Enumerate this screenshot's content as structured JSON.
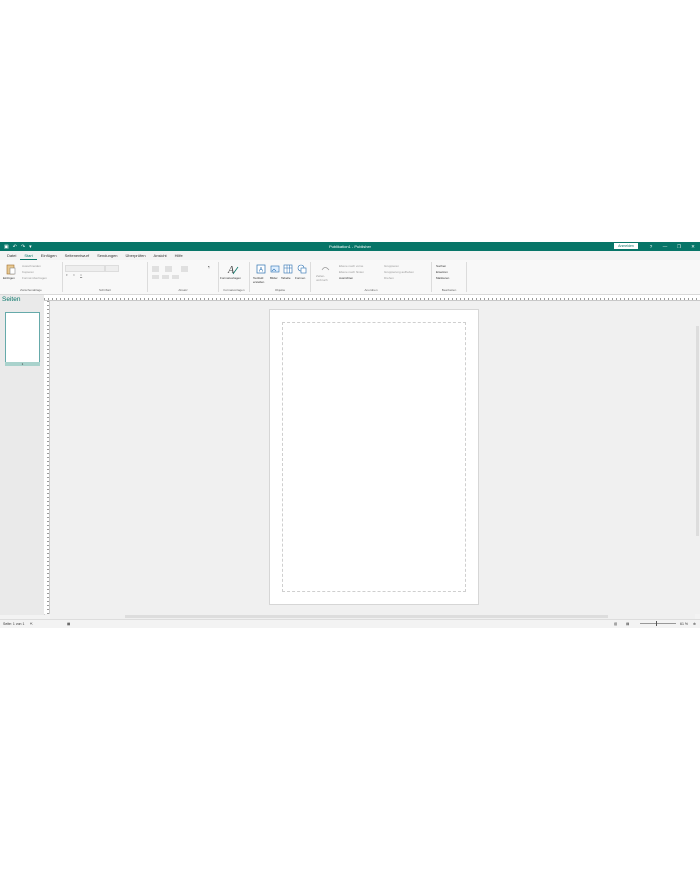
{
  "titlebar": {
    "title": "Publikation1 - Publisher",
    "signin": "Anmelden",
    "help": "?",
    "minimize": "—",
    "restore": "❐",
    "close": "✕",
    "qat": [
      "↶",
      "↷",
      "▾"
    ]
  },
  "menu": {
    "items": [
      "Datei",
      "Start",
      "Einfügen",
      "Seitenentwurf",
      "Sendungen",
      "Überprüfen",
      "Ansicht",
      "Hilfe"
    ],
    "active": "Start"
  },
  "ribbon": {
    "clipboard": {
      "paste": "Einfügen",
      "cut": "Ausschneiden",
      "copy": "Kopieren",
      "format": "Format übertragen",
      "label": "Zwischenablage"
    },
    "font": {
      "label": "Schriftart",
      "bold": "F",
      "italic": "K",
      "underline": "U"
    },
    "paragraph": {
      "label": "Absatz",
      "pilcrow": "¶"
    },
    "styles": {
      "button": "Formatvorlagen",
      "label": "Formatvorlagen"
    },
    "objects": {
      "textbox": "Textfeld erstellen",
      "pictures": "Bilder",
      "table": "Tabelle",
      "shapes": "Formen",
      "label": "Objekte"
    },
    "arrange": {
      "group": "Gruppieren",
      "bring": "Ebene nach vorne",
      "send": "Ebene nach hinten",
      "ungroup": "Gruppierung aufheben",
      "align": "Ausrichten",
      "rotate": "Drehen",
      "wrap": "Zeilen-umbruch",
      "label": "Anordnen"
    },
    "editing": {
      "find": "Suchen",
      "replace": "Ersetzen",
      "select": "Markieren",
      "label": "Bearbeiten"
    }
  },
  "pages_panel": {
    "title": "Seiten",
    "page_number": "1"
  },
  "statusbar": {
    "page": "Seite: 1 von 1",
    "zoom": "61 %"
  }
}
